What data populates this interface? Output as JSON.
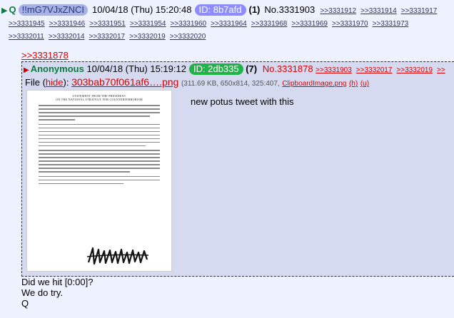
{
  "op": {
    "marker": "▶",
    "name": "Q",
    "tripcode": "!!mG7VJxZNCI",
    "datetime": "10/04/18 (Thu) 15:20:48",
    "id_label": "ID: 8b7afd",
    "post_count": "(1)",
    "post_number": "No.3331903",
    "backlinks_row1": [
      ">>3331912",
      ">>3331914",
      ">>3331917"
    ],
    "backlinks_row2": [
      ">>3331945",
      ">>3331946",
      ">>3331951",
      ">>3331954",
      ">>3331960",
      ">>3331964",
      ">>3331968",
      ">>3331969",
      ">>3331970",
      ">>3331973"
    ],
    "backlinks_row3": [
      ">>3332011",
      ">>3332014",
      ">>3332017",
      ">>3332019",
      ">>3332020"
    ]
  },
  "quote_ref": ">>3331878",
  "reply": {
    "marker": "▶",
    "name": "Anonymous",
    "datetime": "10/04/18 (Thu) 15:19:12",
    "id_label": "ID: 2db335",
    "post_count": "(7)",
    "post_number": "No.3331878",
    "backlinks": [
      ">>3331903",
      ">>3332017",
      ">>3332019",
      ">>"
    ],
    "file_label": "File",
    "hide_open": "(",
    "hide_label": "hide",
    "hide_close": "):",
    "filename": "303bab70f061af6….png",
    "file_meta": "(311.69 KB, 650x814, 325:407,",
    "original_name": "ClipboardImage.png",
    "h_link": "(h)",
    "u_link": "(u)",
    "image_title_line1": "STATEMENT FROM THE PRESIDENT",
    "image_title_line2": "ON THE NATIONAL STRATEGY FOR COUNTERTERRORISM",
    "body_text": "new potus tweet with this"
  },
  "op_message": {
    "line1": "Did we hit [0:00]?",
    "line2": "We do try.",
    "line3": "Q"
  },
  "colors": {
    "background": "#eef2ff",
    "reply_background": "#d6daf0",
    "name_green": "#117743",
    "op_id_pill": "#8d8dff",
    "reply_id_pill": "#21b24a",
    "link_red": "#dd0000"
  }
}
